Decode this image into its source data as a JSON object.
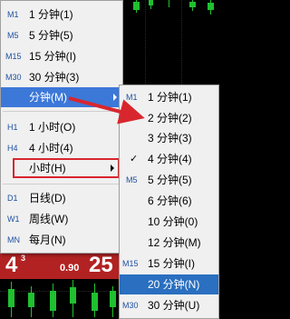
{
  "chart": {
    "price_big": "4",
    "price_sup": "3",
    "price_small": "0.90",
    "price_right": "25"
  },
  "main_menu": {
    "items": [
      {
        "prefix": "M1",
        "label": "1 分钟(1)"
      },
      {
        "prefix": "M5",
        "label": "5 分钟(5)"
      },
      {
        "prefix": "M15",
        "label": "15 分钟(I)"
      },
      {
        "prefix": "M30",
        "label": "30 分钟(3)"
      },
      {
        "prefix": "",
        "label": "分钟(M)"
      },
      {
        "prefix": "H1",
        "label": "1 小时(O)"
      },
      {
        "prefix": "H4",
        "label": "4 小时(4)"
      },
      {
        "prefix": "",
        "label": "小时(H)"
      },
      {
        "prefix": "D1",
        "label": "日线(D)"
      },
      {
        "prefix": "W1",
        "label": "周线(W)"
      },
      {
        "prefix": "MN",
        "label": "每月(N)"
      }
    ]
  },
  "sub_menu": {
    "items": [
      {
        "prefix": "M1",
        "label": "1 分钟(1)"
      },
      {
        "prefix": "",
        "label": "2 分钟(2)"
      },
      {
        "prefix": "",
        "label": "3 分钟(3)"
      },
      {
        "prefix": "✓",
        "label": "4 分钟(4)"
      },
      {
        "prefix": "M5",
        "label": "5 分钟(5)"
      },
      {
        "prefix": "",
        "label": "6 分钟(6)"
      },
      {
        "prefix": "",
        "label": "10 分钟(0)"
      },
      {
        "prefix": "",
        "label": "12 分钟(M)"
      },
      {
        "prefix": "M15",
        "label": "15 分钟(I)"
      },
      {
        "prefix": "",
        "label": "20 分钟(N)"
      },
      {
        "prefix": "M30",
        "label": "30 分钟(U)"
      }
    ]
  },
  "colors": {
    "highlight": "#3c78d8",
    "selected": "#2a6fc0",
    "annotation": "#d8262e",
    "candle": "#20c030",
    "price_bar": "#b22222"
  }
}
